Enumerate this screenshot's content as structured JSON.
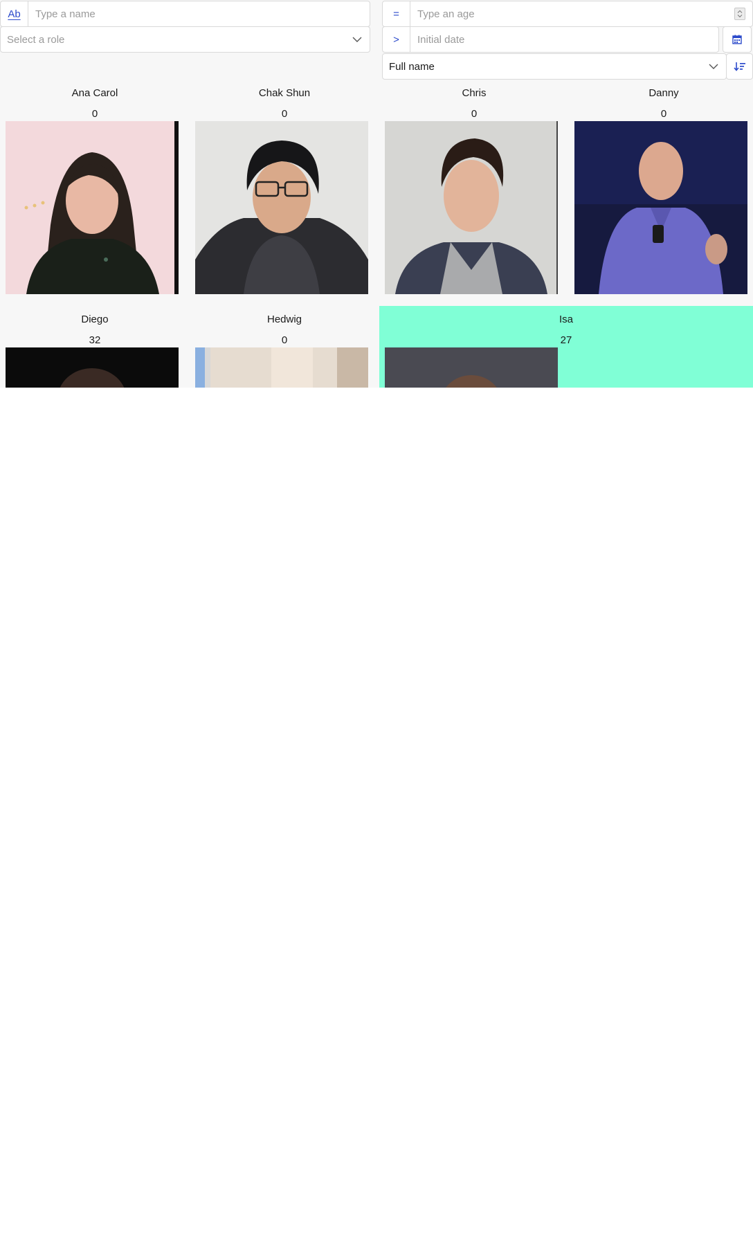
{
  "filters": {
    "name": {
      "prefix": "Ab",
      "placeholder": "Type a name",
      "value": ""
    },
    "role": {
      "placeholder": "Select a role"
    },
    "age": {
      "prefix": "=",
      "placeholder": "Type an age",
      "value": ""
    },
    "date": {
      "prefix": ">",
      "placeholder": "Initial date",
      "value": ""
    },
    "sort": {
      "selected": "Full name"
    }
  },
  "icons": {
    "calendar": "calendar-icon",
    "sort": "sort-descending-icon",
    "chevron": "chevron-down-icon"
  },
  "colors": {
    "accent": "#2b4acb",
    "selected_card": "#80ffd6"
  },
  "people": [
    {
      "name": "Ana Carol",
      "age": "0",
      "selected": false
    },
    {
      "name": "Chak Shun",
      "age": "0",
      "selected": false
    },
    {
      "name": "Chris",
      "age": "0",
      "selected": false
    },
    {
      "name": "Danny",
      "age": "0",
      "selected": false
    },
    {
      "name": "Diego",
      "age": "32",
      "selected": false
    },
    {
      "name": "Hedwig",
      "age": "0",
      "selected": false
    },
    {
      "name": "Isa",
      "age": "27",
      "selected": true
    }
  ]
}
